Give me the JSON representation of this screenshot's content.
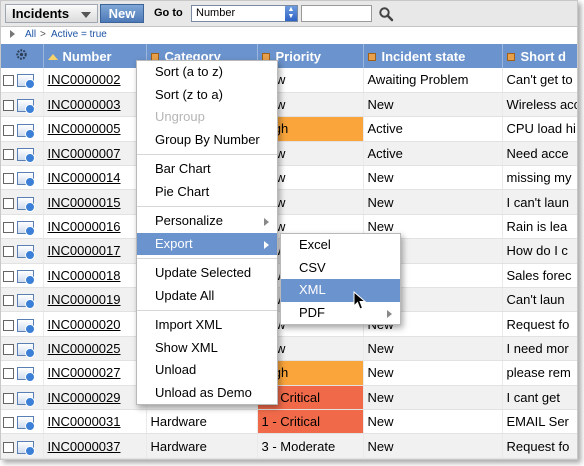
{
  "toolbar": {
    "list_title": "Incidents",
    "new_label": "New",
    "goto_label": "Go to",
    "goto_field": "Number",
    "search_value": ""
  },
  "breadcrumb": {
    "all": "All",
    "separator": ">",
    "filter": "Active = true"
  },
  "columns": [
    "Number",
    "Category",
    "Priority",
    "Incident state",
    "Short d"
  ],
  "rows": [
    {
      "number": "INC0000002",
      "category": "",
      "priority": "Low",
      "priority_level": "normal",
      "state": "Awaiting Problem",
      "short": "Can't get to"
    },
    {
      "number": "INC0000003",
      "category": "",
      "priority": "Low",
      "priority_level": "normal",
      "state": "New",
      "short": "Wireless acc"
    },
    {
      "number": "INC0000005",
      "category": "",
      "priority": "High",
      "priority_level": "high",
      "state": "Active",
      "short": "CPU load hi"
    },
    {
      "number": "INC0000007",
      "category": "",
      "priority": "Low",
      "priority_level": "normal",
      "state": "Active",
      "short": "Need acce"
    },
    {
      "number": "INC0000014",
      "category": "",
      "priority": "Low",
      "priority_level": "normal",
      "state": "New",
      "short": "missing my"
    },
    {
      "number": "INC0000015",
      "category": "",
      "priority": "Low",
      "priority_level": "normal",
      "state": "New",
      "short": "I can't laun"
    },
    {
      "number": "INC0000016",
      "category": "",
      "priority": "Low",
      "priority_level": "normal",
      "state": "New",
      "short": "Rain is lea"
    },
    {
      "number": "INC0000017",
      "category": "",
      "priority": "Low",
      "priority_level": "normal",
      "state": "New",
      "short": "How do I c"
    },
    {
      "number": "INC0000018",
      "category": "",
      "priority": "Low",
      "priority_level": "normal",
      "state": "New",
      "short": "Sales forec"
    },
    {
      "number": "INC0000019",
      "category": "",
      "priority": "Low",
      "priority_level": "normal",
      "state": "New",
      "short": "Can't laun"
    },
    {
      "number": "INC0000020",
      "category": "",
      "priority": "Low",
      "priority_level": "normal",
      "state": "New",
      "short": "Request fo"
    },
    {
      "number": "INC0000025",
      "category": "",
      "priority": "Low",
      "priority_level": "normal",
      "state": "New",
      "short": "I need mor"
    },
    {
      "number": "INC0000027",
      "category": "",
      "priority": "High",
      "priority_level": "high",
      "state": "New",
      "short": "please rem"
    },
    {
      "number": "INC0000029",
      "category": "",
      "priority": "1 - Critical",
      "priority_level": "critical",
      "state": "New",
      "short": "I cant get"
    },
    {
      "number": "INC0000031",
      "category": "Hardware",
      "priority": "1 - Critical",
      "priority_level": "critical",
      "state": "New",
      "short": "EMAIL Ser"
    },
    {
      "number": "INC0000037",
      "category": "Hardware",
      "priority": "3 - Moderate",
      "priority_level": "normal",
      "state": "New",
      "short": "Request fo"
    }
  ],
  "context_menu": {
    "items": [
      {
        "label": "Sort (a to z)",
        "name": "sort-asc"
      },
      {
        "label": "Sort (z to a)",
        "name": "sort-desc"
      },
      {
        "label": "Ungroup",
        "name": "ungroup",
        "disabled": true
      },
      {
        "label": "Group By Number",
        "name": "group-by"
      },
      {
        "sep": true
      },
      {
        "label": "Bar Chart",
        "name": "bar-chart"
      },
      {
        "label": "Pie Chart",
        "name": "pie-chart"
      },
      {
        "sep": true
      },
      {
        "label": "Personalize",
        "name": "personalize",
        "submenu": true
      },
      {
        "label": "Export",
        "name": "export",
        "submenu": true,
        "active": true
      },
      {
        "sep": true
      },
      {
        "label": "Update Selected",
        "name": "update-selected"
      },
      {
        "label": "Update All",
        "name": "update-all"
      },
      {
        "sep": true
      },
      {
        "label": "Import XML",
        "name": "import-xml"
      },
      {
        "label": "Show XML",
        "name": "show-xml"
      },
      {
        "label": "Unload",
        "name": "unload"
      },
      {
        "label": "Unload as Demo",
        "name": "unload-demo"
      }
    ]
  },
  "export_menu": {
    "items": [
      {
        "label": "Excel",
        "name": "excel"
      },
      {
        "label": "CSV",
        "name": "csv"
      },
      {
        "label": "XML",
        "name": "xml",
        "active": true
      },
      {
        "label": "PDF",
        "name": "pdf",
        "submenu": true
      }
    ]
  },
  "colors": {
    "header": "#6b93cd",
    "priority_high": "#f9a53b",
    "priority_critical": "#f06a4a",
    "menu_active": "#6b93cd"
  }
}
